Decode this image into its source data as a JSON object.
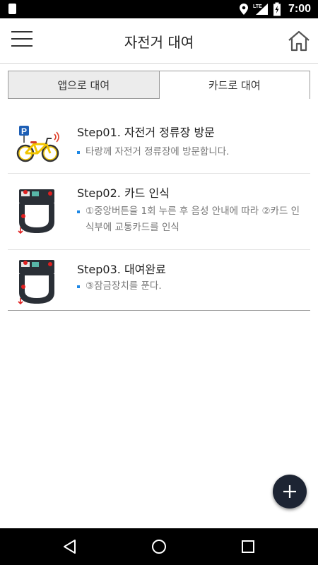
{
  "status_bar": {
    "time": "7:00",
    "network": "LTE"
  },
  "app_bar": {
    "title": "자전거 대여",
    "menu_icon": "hamburger-menu-icon",
    "home_icon": "home-icon"
  },
  "tabs": [
    {
      "label": "앱으로 대여",
      "selected": false
    },
    {
      "label": "카드로 대여",
      "selected": true
    }
  ],
  "steps": [
    {
      "title": "Step01. 자전거 정류장 방문",
      "description": "타랑께 자전거 정류장에 방문합니다.",
      "icon": "bicycle-parking-icon"
    },
    {
      "title": "Step02. 카드 인식",
      "description": "①중앙버튼을 1회 누른 후 음성 안내에 따라 ②카드 인식부에 교통카드를 인식",
      "icon": "bike-lock-terminal-icon"
    },
    {
      "title": "Step03. 대여완료",
      "description": "③잠금장치를 푼다.",
      "icon": "bike-lock-terminal-icon"
    }
  ],
  "fab": {
    "icon": "plus-icon"
  },
  "colors": {
    "accent_bullet": "#1e88e5",
    "fab": "#1d2433",
    "parking_sign": "#1e5fb5"
  }
}
